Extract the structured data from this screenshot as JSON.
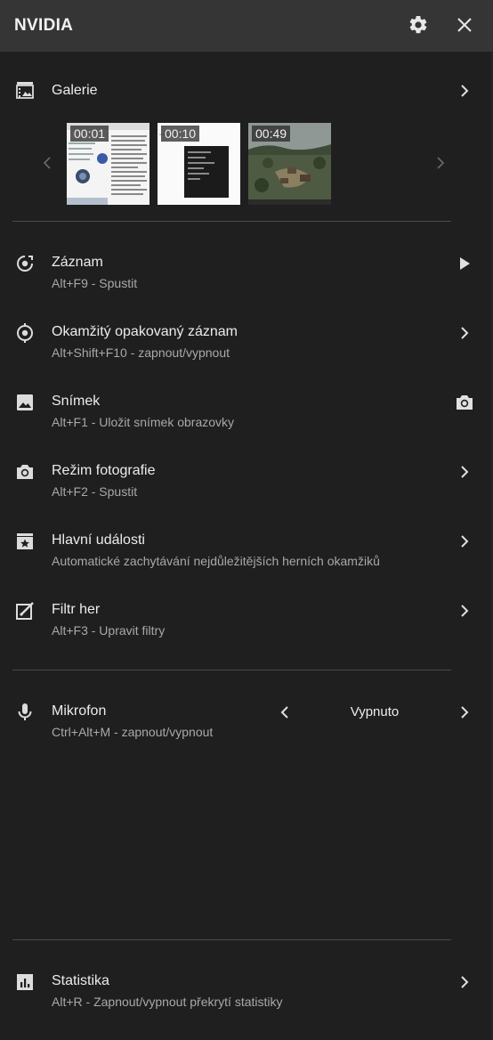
{
  "header": {
    "brand": "NVIDIA",
    "settings_icon": "gear-icon",
    "close_icon": "close-icon"
  },
  "gallery": {
    "label": "Galerie",
    "icon": "gallery-icon",
    "thumbnails": [
      {
        "duration": "00:01"
      },
      {
        "duration": "00:10"
      },
      {
        "duration": "00:49"
      }
    ]
  },
  "items": [
    {
      "title": "Záznam",
      "subtitle": "Alt+F9 - Spustit",
      "icon": "record-icon",
      "action_icon": "play-icon"
    },
    {
      "title": "Okamžitý opakovaný záznam",
      "subtitle": "Alt+Shift+F10 - zapnout/vypnout",
      "icon": "instant-replay-icon",
      "action_icon": "chevron-right-icon"
    },
    {
      "title": "Snímek",
      "subtitle": "Alt+F1 - Uložit snímek obrazovky",
      "icon": "image-icon",
      "action_icon": "camera-icon"
    },
    {
      "title": "Režim fotografie",
      "subtitle": "Alt+F2 - Spustit",
      "icon": "camera-icon",
      "action_icon": "chevron-right-icon"
    },
    {
      "title": "Hlavní události",
      "subtitle": "Automatické zachytávání nejdůležitějších herních okamžiků",
      "icon": "highlights-icon",
      "action_icon": "chevron-right-icon"
    },
    {
      "title": "Filtr her",
      "subtitle": "Alt+F3 - Upravit filtry",
      "icon": "filter-icon",
      "action_icon": "chevron-right-icon"
    }
  ],
  "microphone": {
    "title": "Mikrofon",
    "subtitle": "Ctrl+Alt+M - zapnout/vypnout",
    "value": "Vypnuto",
    "icon": "microphone-icon"
  },
  "statistics": {
    "title": "Statistika",
    "subtitle": "Alt+R - Zapnout/vypnout překrytí statistiky",
    "icon": "statistics-icon"
  },
  "colors": {
    "background": "#1f1f1f",
    "header": "#353535",
    "text": "#ececec",
    "subtext": "#a9a9a9",
    "divider": "#4a4a4a"
  }
}
